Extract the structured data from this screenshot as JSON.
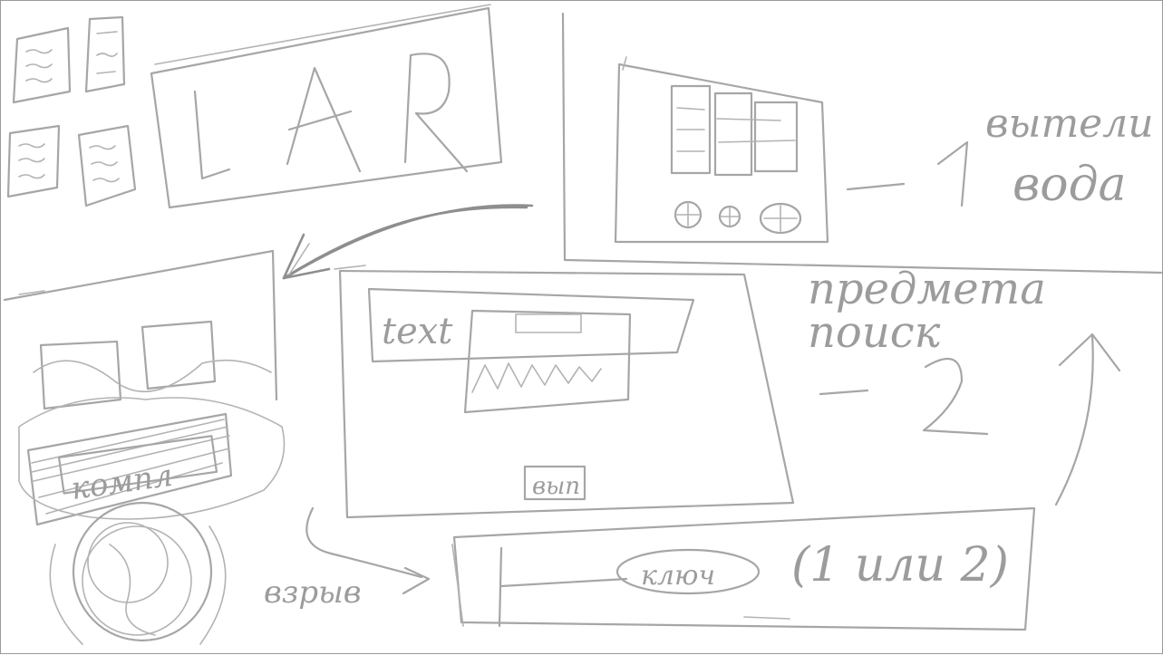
{
  "sketch": {
    "logo": {
      "text": "LAR"
    },
    "top_right": {
      "label_word": "вытели",
      "label_line2": "— 1",
      "label_word2": "вода"
    },
    "middle_right": {
      "line1": "предмета",
      "line2": "поиск",
      "line3": "— 2"
    },
    "form": {
      "field_label": "text",
      "button_label": "вып"
    },
    "left_panel": {
      "label": "компл"
    },
    "bottom": {
      "arrow_label": "взрыв",
      "pill_label": "ключ",
      "choice_label": "(1 или 2)"
    }
  }
}
